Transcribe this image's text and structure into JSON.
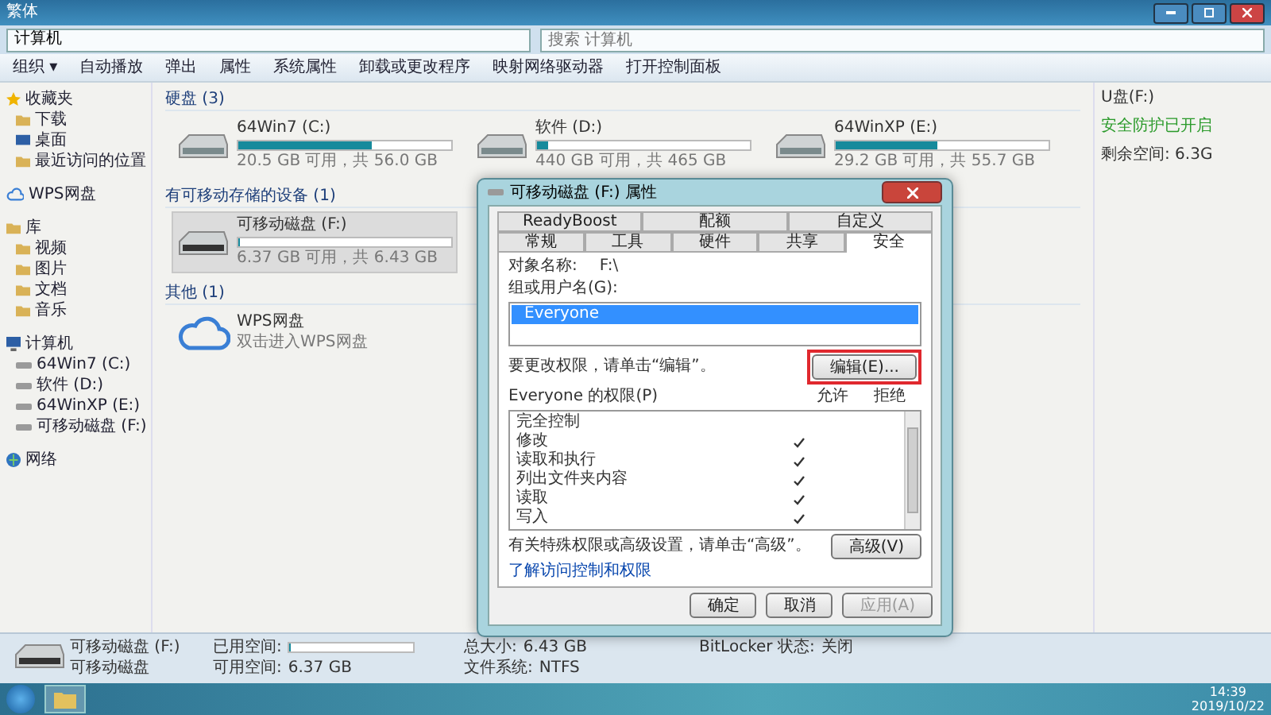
{
  "desktop_label": "繁体",
  "address": {
    "path": "计算机",
    "search_placeholder": "搜索 计算机"
  },
  "toolbar": [
    "组织 ▾",
    "自动播放",
    "弹出",
    "属性",
    "系统属性",
    "卸载或更改程序",
    "映射网络驱动器",
    "打开控制面板"
  ],
  "sidebar": [
    {
      "label": "收藏夹",
      "kind": "header"
    },
    {
      "label": "下载",
      "kind": "item"
    },
    {
      "label": "桌面",
      "kind": "item"
    },
    {
      "label": "最近访问的位置",
      "kind": "item"
    },
    {
      "label": "WPS网盘",
      "kind": "header"
    },
    {
      "label": "库",
      "kind": "header"
    },
    {
      "label": "视频",
      "kind": "item"
    },
    {
      "label": "图片",
      "kind": "item"
    },
    {
      "label": "文档",
      "kind": "item"
    },
    {
      "label": "音乐",
      "kind": "item"
    },
    {
      "label": "计算机",
      "kind": "header"
    },
    {
      "label": "64Win7 (C:)",
      "kind": "item"
    },
    {
      "label": "软件 (D:)",
      "kind": "item"
    },
    {
      "label": "64WinXP (E:)",
      "kind": "item"
    },
    {
      "label": "可移动磁盘 (F:)",
      "kind": "item"
    },
    {
      "label": "网络",
      "kind": "header"
    }
  ],
  "groups": [
    {
      "title": "硬盘 (3)",
      "items": [
        {
          "name": "64Win7 (C:)",
          "level": 0.63,
          "info": "20.5 GB 可用，共 56.0 GB",
          "selected": false,
          "kind": "drive"
        },
        {
          "name": "软件 (D:)",
          "level": 0.05,
          "info": "440 GB 可用，共 465 GB",
          "selected": false,
          "kind": "drive"
        },
        {
          "name": "64WinXP (E:)",
          "level": 0.48,
          "info": "29.2 GB 可用，共 55.7 GB",
          "selected": false,
          "kind": "drive"
        }
      ]
    },
    {
      "title": "有可移动存储的设备 (1)",
      "items": [
        {
          "name": "可移动磁盘 (F:)",
          "level": 0.01,
          "info": "6.37 GB 可用，共 6.43 GB",
          "selected": true,
          "kind": "drive"
        }
      ]
    },
    {
      "title": "其他 (1)",
      "items": [
        {
          "name": "WPS网盘",
          "info": "双击进入WPS网盘",
          "selected": false,
          "kind": "cloud"
        }
      ]
    }
  ],
  "details_pane": {
    "name": "U盘(F:)",
    "status": "安全防护已开启",
    "free": "剩余空间: 6.3G"
  },
  "dialog": {
    "title": "可移动磁盘 (F:) 属性",
    "tabs_back": [
      {
        "label": "ReadyBoost",
        "selected": false
      },
      {
        "label": "配额",
        "selected": false
      },
      {
        "label": "自定义",
        "selected": false
      }
    ],
    "tabs_front": [
      {
        "label": "常规",
        "selected": false
      },
      {
        "label": "工具",
        "selected": false
      },
      {
        "label": "硬件",
        "selected": false
      },
      {
        "label": "共享",
        "selected": false
      },
      {
        "label": "安全",
        "selected": true
      }
    ],
    "object_label": "对象名称:",
    "object_value": "F:\\",
    "users_label": "组或用户名(G):",
    "users": [
      {
        "name": "Everyone",
        "selected": true
      }
    ],
    "edit_hint": "要更改权限，请单击“编辑”。",
    "edit_button": "编辑(E)...",
    "perm_title": "Everyone 的权限(P)",
    "allow": "允许",
    "deny": "拒绝",
    "permissions": [
      {
        "name": "完全控制",
        "allow": false
      },
      {
        "name": "修改",
        "allow": true
      },
      {
        "name": "读取和执行",
        "allow": true
      },
      {
        "name": "列出文件夹内容",
        "allow": true
      },
      {
        "name": "读取",
        "allow": true
      },
      {
        "name": "写入",
        "allow": true
      }
    ],
    "advanced_hint": "有关特殊权限或高级设置，请单击“高级”。",
    "advanced_button": "高级(V)",
    "link": "了解访问控制和权限",
    "buttons": [
      {
        "label": "确定",
        "disabled": false
      },
      {
        "label": "取消",
        "disabled": false
      },
      {
        "label": "应用(A)",
        "disabled": true
      }
    ]
  },
  "status_bar": {
    "name": "可移动磁盘 (F:)",
    "type": "可移动磁盘",
    "used_label": "已用空间:",
    "level": 0.01,
    "free_label": "可用空间:",
    "free": "6.37 GB",
    "total_label": "总大小:",
    "total": "6.43 GB",
    "fs_label": "文件系统:",
    "fs": "NTFS",
    "bitlocker_label": "BitLocker 状态:",
    "bitlocker": "关闭"
  },
  "taskbar": {
    "time": "14:39",
    "date": "2019/10/22"
  }
}
